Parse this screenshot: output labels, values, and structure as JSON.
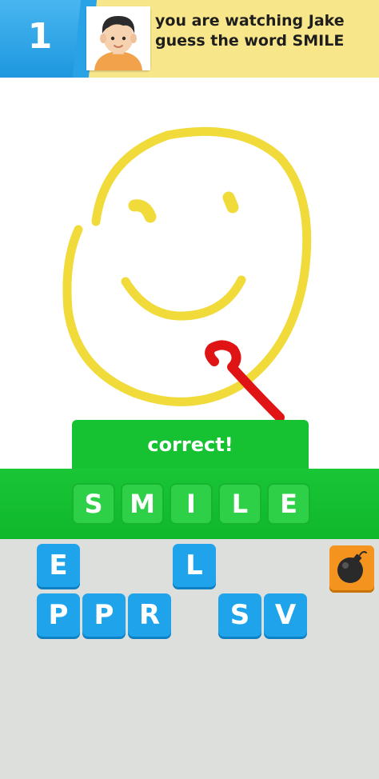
{
  "header": {
    "round_number": "1",
    "watching_text": "you are watching Jake guess the word SMILE"
  },
  "result": {
    "status_text": "correct!",
    "answer_letters": [
      "S",
      "M",
      "I",
      "L",
      "E"
    ]
  },
  "letter_bank": {
    "row1": [
      "E",
      "L"
    ],
    "row2": [
      "P",
      "P",
      "R",
      "S",
      "V"
    ]
  },
  "icons": {
    "avatar": "boy-avatar-icon",
    "bomb": "bomb-icon"
  },
  "colors": {
    "drawing_yellow": "#f0db3a",
    "drawing_red": "#e01414",
    "correct_green": "#16c232",
    "tile_blue": "#1fa3ea",
    "bomb_orange": "#f4941f"
  }
}
